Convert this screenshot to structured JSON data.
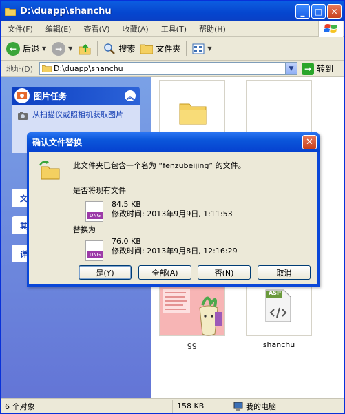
{
  "window": {
    "title": "D:\\duapp\\shanchu",
    "minimize": "_",
    "maximize": "□",
    "close": "✕"
  },
  "menu": {
    "items": [
      "文件(F)",
      "编辑(E)",
      "查看(V)",
      "收藏(A)",
      "工具(T)",
      "帮助(H)"
    ]
  },
  "toolbar": {
    "back": "后退",
    "search": "搜索",
    "folders": "文件夹"
  },
  "address": {
    "label": "地址(D)",
    "path": "D:\\duapp\\shanchu",
    "go": "转到"
  },
  "leftpane": {
    "task_title": "图片任务",
    "task_link": "从扫描仪或照相机获取图片",
    "panel2": "文",
    "panel3": "其",
    "panel4": "详"
  },
  "content": {
    "items": [
      {
        "label": "gg"
      },
      {
        "label": "shanchu",
        "badge": "ASP"
      }
    ]
  },
  "status": {
    "objects": "6 个对象",
    "size": "158 KB",
    "location": "我的电脑"
  },
  "dialog": {
    "title": "确认文件替换",
    "close": "✕",
    "message": "此文件夹已包含一个名为 “fenzubeijing” 的文件。",
    "question": "是否将现有文件",
    "existing_size": "84.5 KB",
    "existing_modified": "修改时间: 2013年9月9日, 1:11:53",
    "replace_with": "替换为",
    "new_size": "76.0 KB",
    "new_modified": "修改时间: 2013年9月8日, 12:16:29",
    "file_tag": "DNG",
    "buttons": {
      "yes": "是(Y)",
      "all": "全部(A)",
      "no": "否(N)",
      "cancel": "取消"
    }
  }
}
